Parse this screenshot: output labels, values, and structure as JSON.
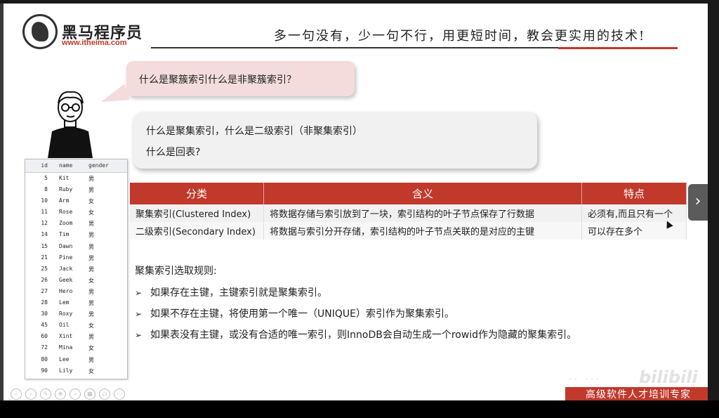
{
  "header": {
    "brand_name": "黑马程序员",
    "brand_url": "www.itheima.com",
    "slogan": "多一句没有，少一句不行，用更短时间，教会更实用的技术!"
  },
  "question_bubble": {
    "text": "什么是聚簇索引什么是非聚簇索引？"
  },
  "answer_bubble": {
    "line1": "什么是聚集索引，什么是二级索引（非聚集索引）",
    "line2": "什么是回表?"
  },
  "data_table": {
    "columns": [
      "id",
      "name",
      "gender"
    ],
    "rows": [
      [
        "5",
        "Kit",
        "男"
      ],
      [
        "8",
        "Ruby",
        "男"
      ],
      [
        "10",
        "Arm",
        "女"
      ],
      [
        "11",
        "Rose",
        "女"
      ],
      [
        "12",
        "Zoom",
        "男"
      ],
      [
        "14",
        "Tim",
        "男"
      ],
      [
        "15",
        "Dawn",
        "男"
      ],
      [
        "21",
        "Pine",
        "男"
      ],
      [
        "25",
        "Jack",
        "男"
      ],
      [
        "26",
        "Geek",
        "女"
      ],
      [
        "27",
        "Hero",
        "男"
      ],
      [
        "28",
        "Lem",
        "男"
      ],
      [
        "30",
        "Roxy",
        "男"
      ],
      [
        "45",
        "Oil",
        "女"
      ],
      [
        "60",
        "Xint",
        "男"
      ],
      [
        "72",
        "Mina",
        "女"
      ],
      [
        "80",
        "Lee",
        "男"
      ],
      [
        "90",
        "Lily",
        "女"
      ]
    ]
  },
  "index_table": {
    "headers": [
      "分类",
      "含义",
      "特点"
    ],
    "rows": [
      [
        "聚集索引(Clustered Index)",
        "将数据存储与索引放到了一块，索引结构的叶子节点保存了行数据",
        "必须有,而且只有一个"
      ],
      [
        "二级索引(Secondary Index)",
        "将数据与索引分开存储，索引结构的叶子节点关联的是对应的主键",
        "可以存在多个"
      ]
    ]
  },
  "rules": {
    "title": "聚集索引选取规则:",
    "items": [
      "如果存在主键，主键索引就是聚集索引。",
      "如果不存在主键，将使用第一个唯一（UNIQUE）索引作为聚集索引。",
      "如果表没有主键，或没有合适的唯一索引，则InnoDB会自动生成一个rowid作为隐藏的聚集索引。"
    ],
    "bullet": "➢"
  },
  "nav": {
    "next_glyph": "›"
  },
  "footer": {
    "brand": "高级软件人才培训专家",
    "watermark": "bilibili"
  },
  "colors": {
    "accent": "#c0392b",
    "bubble_pink": "#f4dcdc",
    "bubble_gray": "#f1f1f1"
  }
}
